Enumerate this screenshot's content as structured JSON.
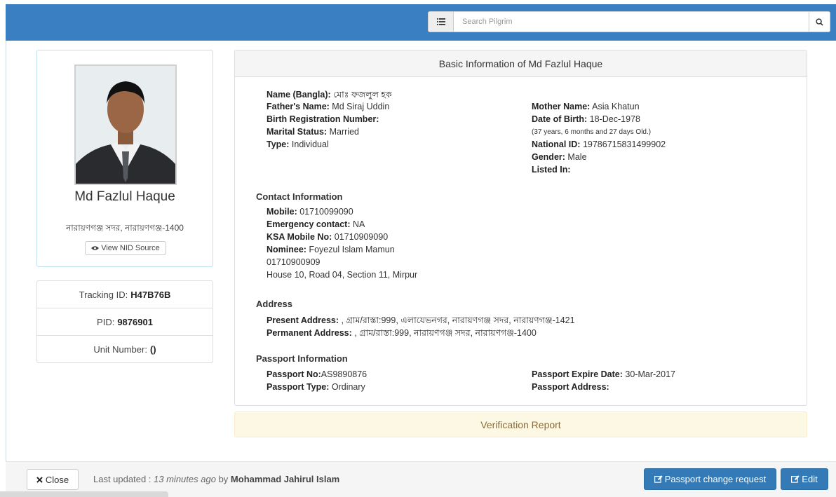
{
  "search": {
    "placeholder": "Search Pilgrim",
    "menu_icon": "list-icon",
    "search_icon": "search-icon"
  },
  "profile": {
    "name": "Md Fazlul Haque",
    "area": "নারায়ণগঞ্জ সদর, নারায়ণগঞ্জ-1400",
    "nid_button": "View NID Source",
    "tracking_label": "Tracking ID:",
    "tracking_id": "H47B76B",
    "pid_label": "PID:",
    "pid": "9876901",
    "unit_label": "Unit Number:",
    "unit_value": "()"
  },
  "basic": {
    "header": "Basic Information of Md Fazlul Haque",
    "name_bangla_label": "Name (Bangla):",
    "name_bangla": "মোঃ ফজলুল হক",
    "father_label": "Father's Name:",
    "father": "Md Siraj Uddin",
    "birth_reg_label": "Birth Registration Number:",
    "birth_reg": "",
    "marital_label": "Marital Status:",
    "marital": "Married",
    "type_label": "Type:",
    "type": "Individual",
    "mother_label": "Mother Name:",
    "mother": "Asia Khatun",
    "dob_label": "Date of Birth:",
    "dob": "18-Dec-1978",
    "age": "(37 years, 6 months and 27 days Old.)",
    "nid_label": "National ID:",
    "nid": "19786715831499902",
    "gender_label": "Gender:",
    "gender": "Male",
    "listed_label": "Listed In:",
    "listed": ""
  },
  "contact": {
    "title": "Contact Information",
    "mobile_label": "Mobile:",
    "mobile": "01710099090",
    "emergency_label": "Emergency contact:",
    "emergency": "NA",
    "ksa_label": "KSA Mobile No:",
    "ksa": "01710909090",
    "nominee_label": "Nominee:",
    "nominee": "Foyezul Islam Mamun",
    "nominee_phone": "01710900909",
    "nominee_address": "House 10, Road 04, Section 11, Mirpur"
  },
  "address": {
    "title": "Address",
    "present_label": "Present Address:",
    "present": ", গ্রাম/রাস্তা:999, এলাযেভনগর, নারায়ণগঞ্জ সদর, নারায়ণগঞ্জ-1421",
    "permanent_label": "Permanent Address:",
    "permanent": ", গ্রাম/রাস্তা:999, নারায়ণগঞ্জ সদর, নারায়ণগঞ্জ-1400"
  },
  "passport": {
    "title": "Passport Information",
    "no_label": "Passport No:",
    "no": "AS9890876",
    "type_label": "Passport Type:",
    "type": "Ordinary",
    "expire_label": "Passport Expire Date:",
    "expire": "30-Mar-2017",
    "address_label": "Passport Address:",
    "address": ""
  },
  "verification": {
    "title": "Verification Report"
  },
  "footer": {
    "close": "Close",
    "updated_prefix": "Last updated :",
    "updated_time": "13 minutes ago",
    "updated_by_word": "by",
    "updated_by": "Mohammad Jahirul Islam",
    "passport_change": "Passport change request",
    "edit": "Edit"
  }
}
